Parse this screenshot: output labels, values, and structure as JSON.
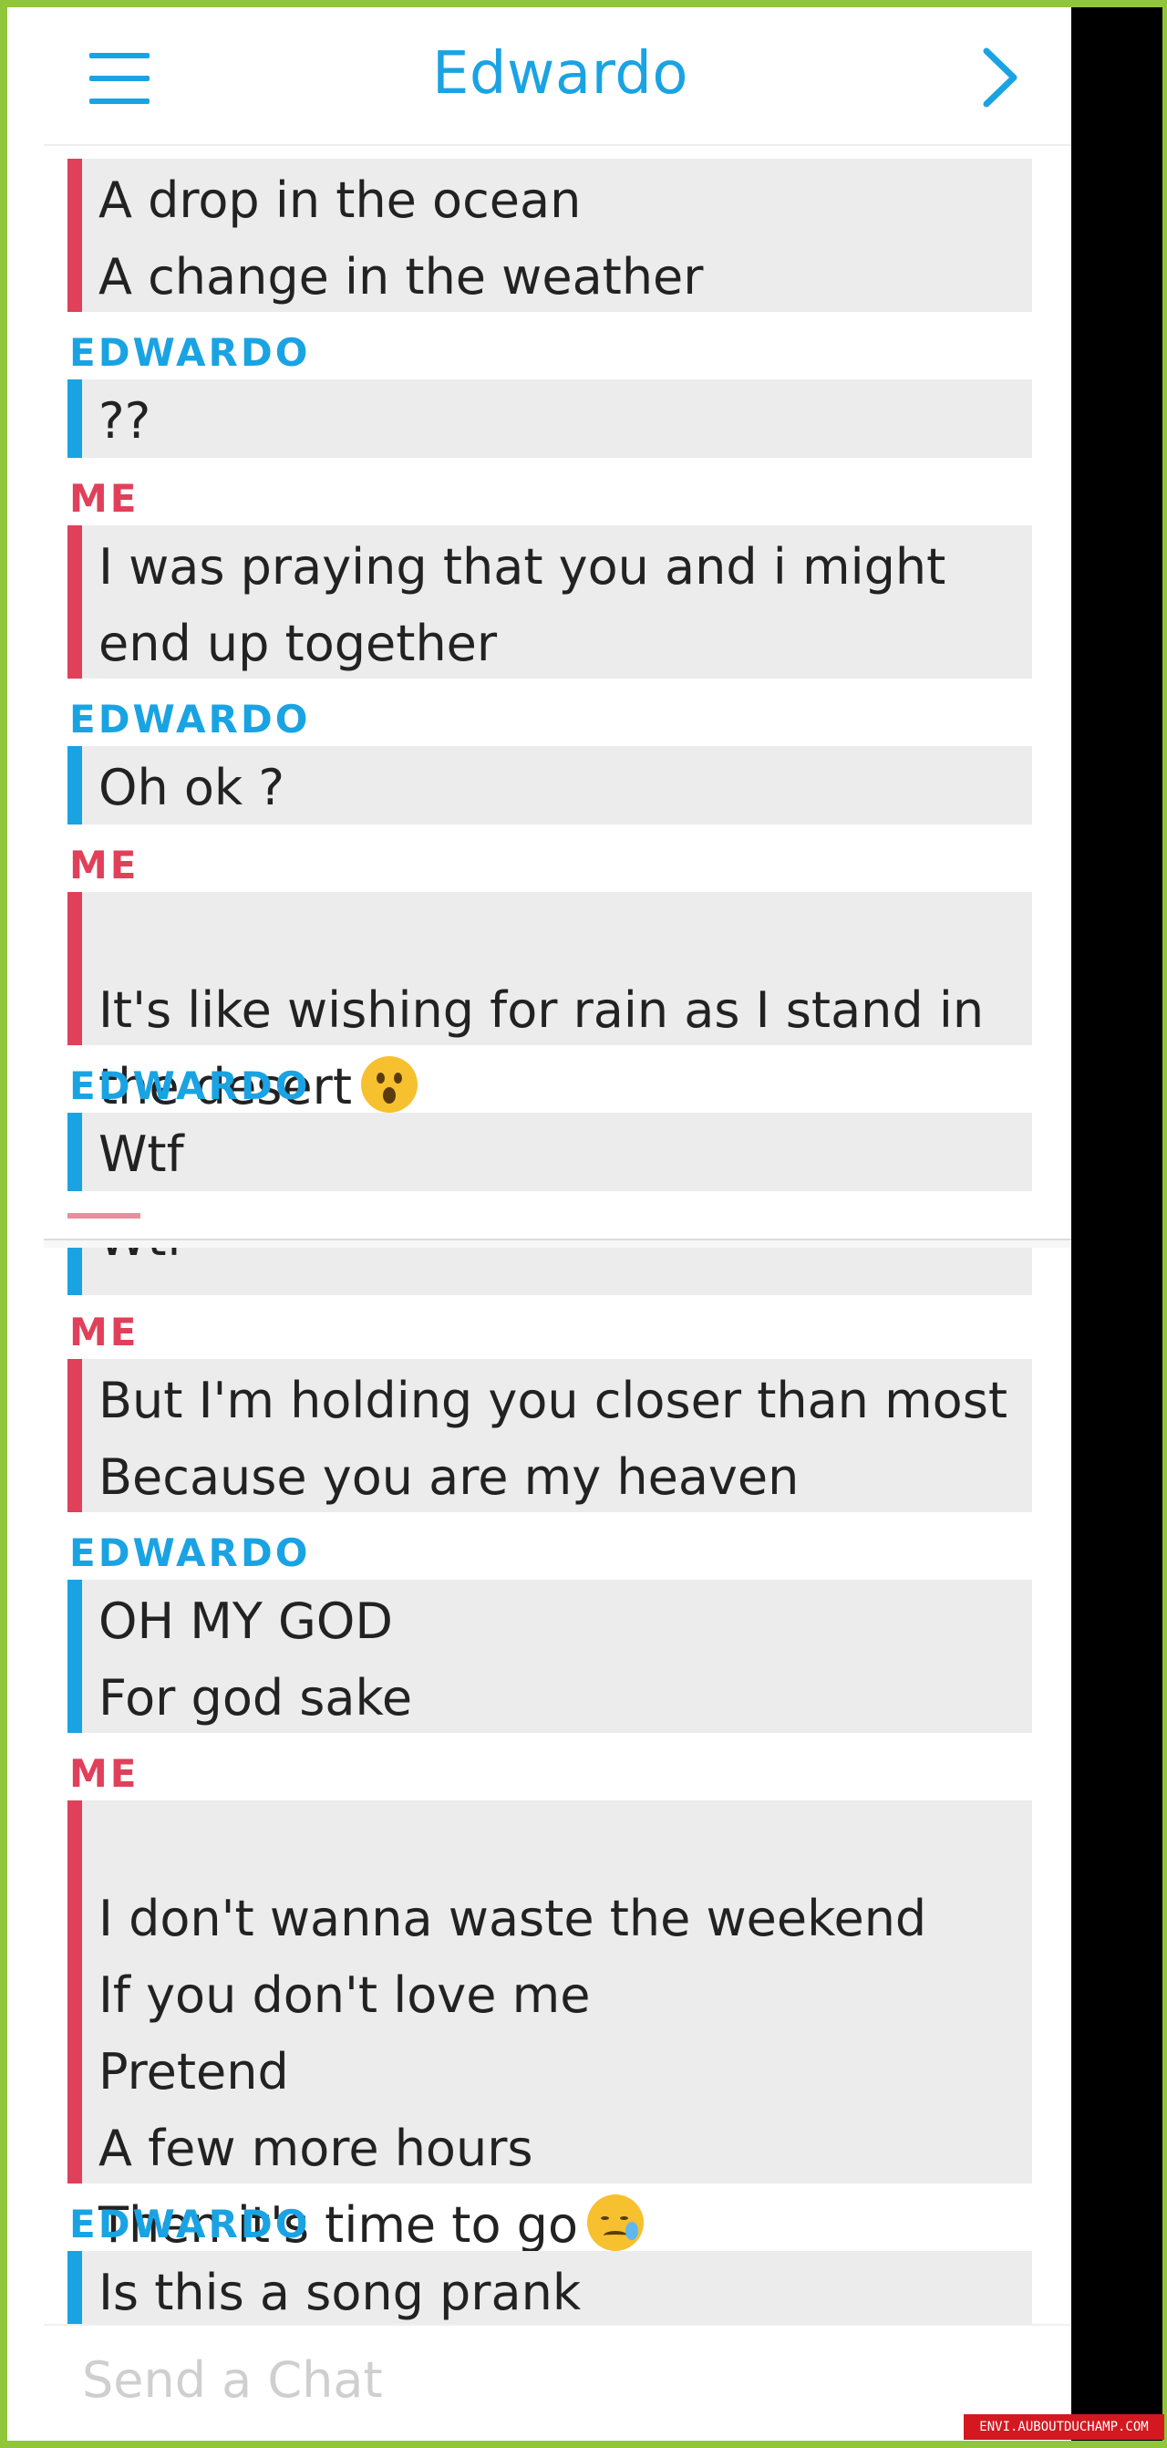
{
  "header": {
    "title": "Edwardo"
  },
  "messages": [
    {
      "sender": "",
      "lines": "A drop in the ocean\nA change in the weather"
    },
    {
      "sender": "EDWARDO",
      "lines": "??"
    },
    {
      "sender": "ME",
      "lines": "I was praying that you and i might\nend up together"
    },
    {
      "sender": "EDWARDO",
      "lines": "Oh ok ?"
    },
    {
      "sender": "ME",
      "lines": "It's like wishing for rain as I stand in\nthe desert"
    },
    {
      "sender": "EDWARDO",
      "lines": "Wtf"
    },
    {
      "sender": "",
      "lines": "Wtf"
    },
    {
      "sender": "ME",
      "lines": "But I'm holding you closer than most\nBecause you are my heaven"
    },
    {
      "sender": "EDWARDO",
      "lines": "OH MY GOD\nFor god sake"
    },
    {
      "sender": "ME",
      "lines": "I don't wanna waste the weekend\nIf you don't love me\nPretend\nA few more hours\nThen it's time to go"
    },
    {
      "sender": "EDWARDO",
      "lines": "Is this a song prank"
    }
  ],
  "composer": {
    "placeholder": "Send a Chat"
  },
  "watermark": "ENVI.AUBOUTDUCHAMP.COM",
  "colors": {
    "accent_blue": "#1aa3e3",
    "me_red": "#e0405a",
    "bubble_bg": "#ececec",
    "frame_green": "#90c63a"
  }
}
